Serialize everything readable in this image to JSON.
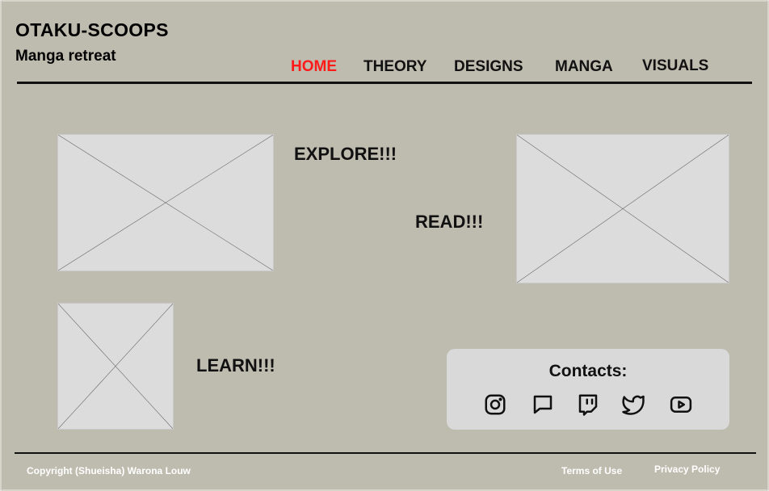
{
  "header": {
    "title": "OTAKU-SCOOPS",
    "subtitle": "Manga retreat"
  },
  "nav": {
    "items": [
      {
        "label": "HOME",
        "active": true
      },
      {
        "label": "THEORY",
        "active": false
      },
      {
        "label": "DESIGNS",
        "active": false
      },
      {
        "label": "MANGA",
        "active": false
      },
      {
        "label": "VISUALS",
        "active": false
      }
    ],
    "active_color": "#ff1a1a"
  },
  "main": {
    "explore_label": "EXPLORE!!!",
    "read_label": "READ!!!",
    "learn_label": "LEARN!!!"
  },
  "contacts": {
    "title": "Contacts:",
    "icons": [
      "instagram-icon",
      "message-icon",
      "twitch-icon",
      "twitter-icon",
      "youtube-icon"
    ]
  },
  "footer": {
    "copyright": "Copyright (Shueisha) Warona Louw",
    "terms": "Terms of Use",
    "privacy": "Privacy Policy"
  },
  "colors": {
    "background": "#bebbaf",
    "placeholder": "#dcdcdc",
    "contacts_panel": "#d9d9d9"
  }
}
